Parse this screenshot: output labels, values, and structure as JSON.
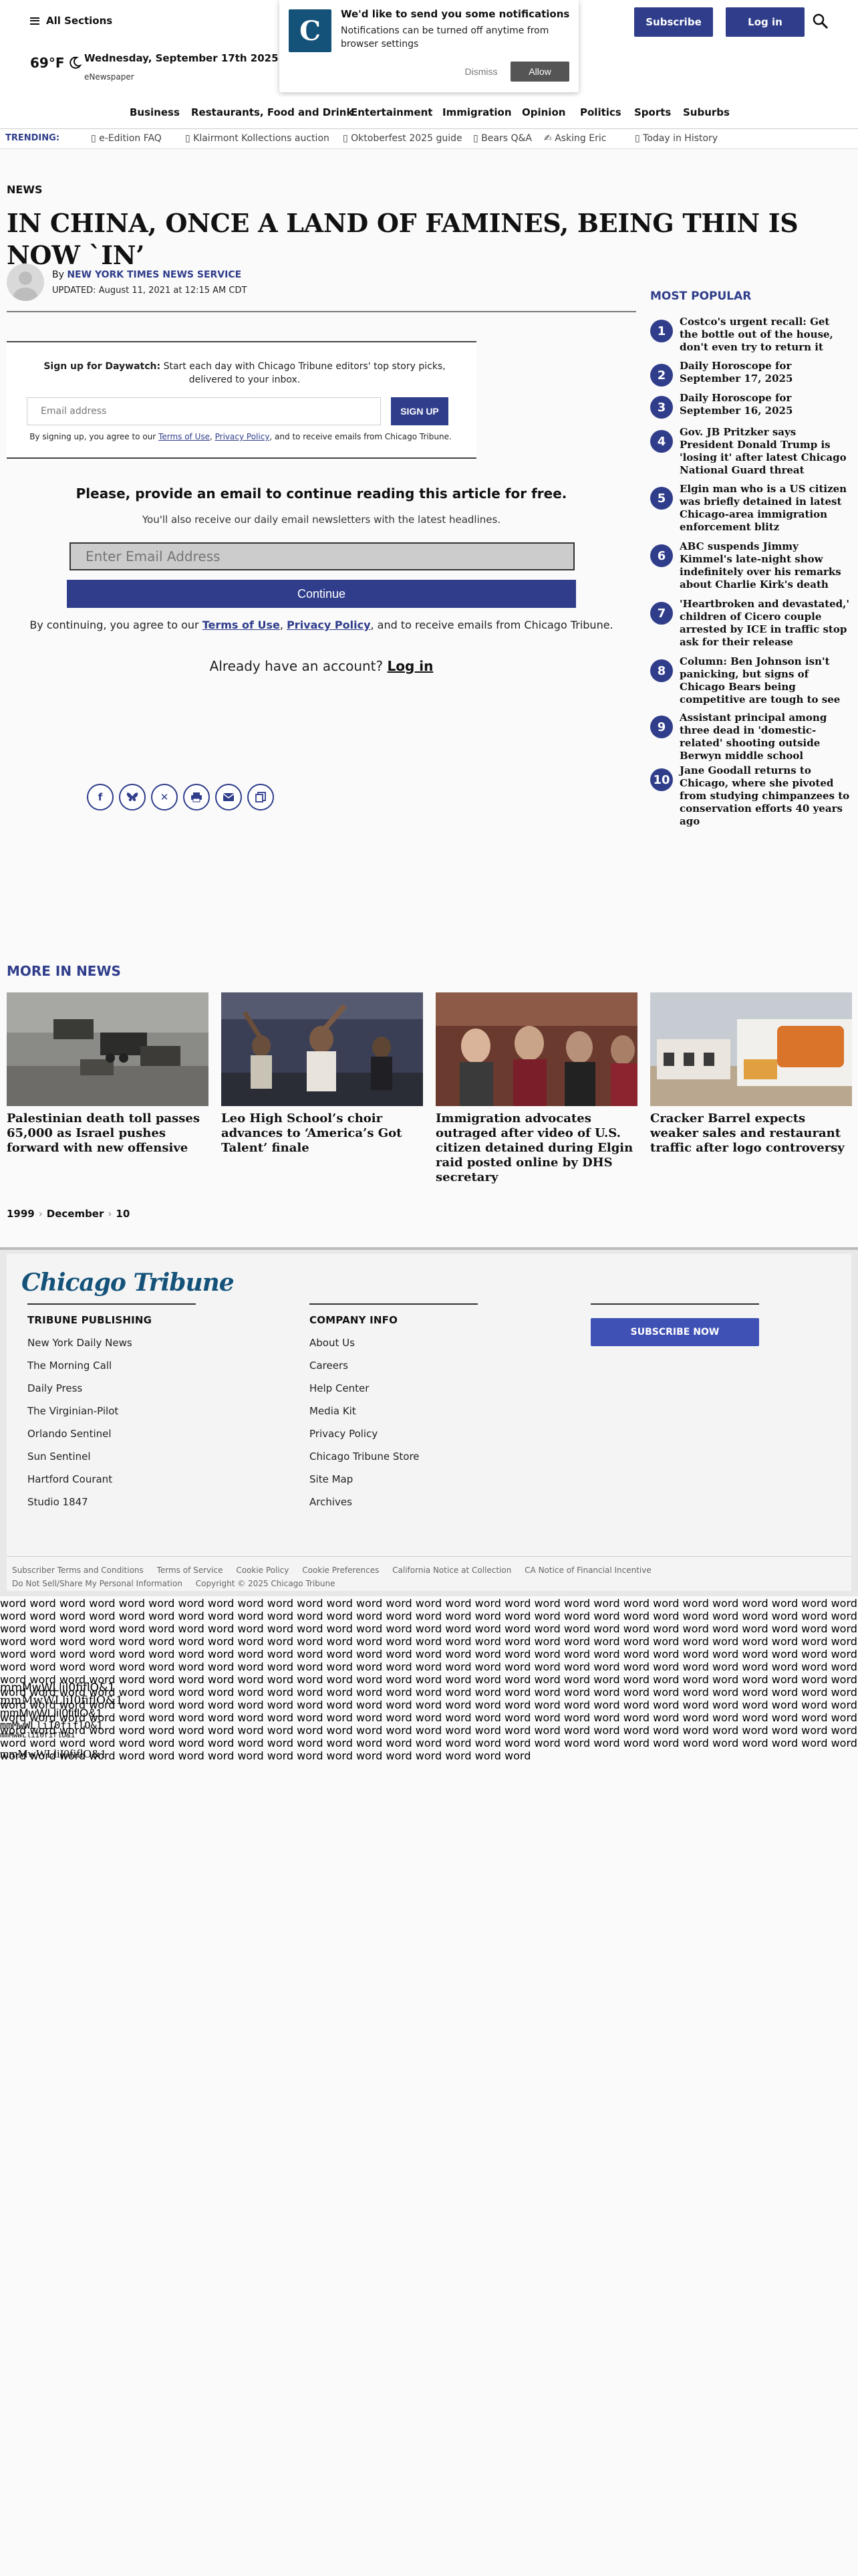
{
  "header": {
    "all_sections": "All Sections",
    "weather": "69°F",
    "date": "Wednesday, September 17th 2025",
    "enewspaper": "eNewspaper",
    "subscribe": "Subscribe",
    "login": "Log in"
  },
  "notification": {
    "logo_letter": "C",
    "title": "We'd like to send you some notifications",
    "text": "Notifications can be turned off anytime from browser settings",
    "dismiss": "Dismiss",
    "allow": "Allow"
  },
  "nav": {
    "items": [
      "Business",
      "Restaurants, Food and Drink",
      "Entertainment",
      "Immigration",
      "Opinion",
      "Politics",
      "Sports",
      "Suburbs"
    ]
  },
  "trending": {
    "label": "TRENDING:",
    "items": [
      "e-Edition FAQ",
      "Klairmont Kollections auction",
      "Oktoberfest 2025 guide",
      "Bears Q&A",
      "Asking Eric",
      "Today in History"
    ]
  },
  "article": {
    "section": "NEWS",
    "headline": "IN CHINA, ONCE A LAND OF FAMINES, BEING THIN IS NOW `IN’",
    "by_prefix": "By",
    "author": "NEW YORK TIMES NEWS SERVICE",
    "updated": "UPDATED: August 11, 2021 at 12:15 AM CDT"
  },
  "signup": {
    "lead": "Sign up for Daywatch:",
    "text": "Start each day with Chicago Tribune editors' top story picks, delivered to your inbox.",
    "placeholder": "Email address",
    "button": "SIGN UP",
    "legal_pre": "By signing up, you agree to our",
    "terms": "Terms of Use",
    "privacy": "Privacy Policy",
    "legal_post": ", and to receive emails from Chicago Tribune."
  },
  "paywall": {
    "title": "Please, provide an email to continue reading this article for free.",
    "subtitle": "You'll also receive our daily email newsletters with the latest headlines.",
    "placeholder": "Enter Email Address",
    "button": "Continue",
    "legal_pre": "By continuing, you agree to our",
    "terms": "Terms of Use",
    "privacy": "Privacy Policy",
    "legal_post": ", and to receive emails from Chicago Tribune.",
    "login_prompt": "Already have an account?",
    "login_link": "Log in"
  },
  "share": {
    "icons": [
      "facebook-icon",
      "bluesky-icon",
      "x-icon",
      "print-icon",
      "email-icon",
      "copy-link-icon"
    ]
  },
  "most_popular": {
    "title": "MOST POPULAR",
    "items": [
      {
        "num": "1",
        "text": "Costco's urgent recall: Get the bottle out of the house, don't even try to return it"
      },
      {
        "num": "2",
        "text": "Daily Horoscope for September 17, 2025"
      },
      {
        "num": "3",
        "text": "Daily Horoscope for September 16, 2025"
      },
      {
        "num": "4",
        "text": "Gov. JB Pritzker says President Donald Trump is 'losing it' after latest Chicago National Guard threat"
      },
      {
        "num": "5",
        "text": "Elgin man who is a US citizen was briefly detained in latest Chicago-area immigration enforcement blitz"
      },
      {
        "num": "6",
        "text": "ABC suspends Jimmy Kimmel's late-night show indefinitely over his remarks about Charlie Kirk's death"
      },
      {
        "num": "7",
        "text": "'Heartbroken and devastated,' children of Cicero couple arrested by ICE in traffic stop ask for their release"
      },
      {
        "num": "8",
        "text": "Column: Ben Johnson isn't panicking, but signs of Chicago Bears being competitive are tough to see"
      },
      {
        "num": "9",
        "text": "Assistant principal among three dead in 'domestic-related' shooting outside Berwyn middle school"
      },
      {
        "num": "10",
        "text": "Jane Goodall returns to Chicago, where she pivoted from studying chimpanzees to conservation efforts 40 years ago"
      }
    ]
  },
  "more_in_news": {
    "title": "MORE IN NEWS",
    "items": [
      {
        "headline": "Palestinian death toll passes 65,000 as Israel pushes forward with new offensive"
      },
      {
        "headline": "Leo High School’s choir advances to ‘America’s Got Talent’ finale"
      },
      {
        "headline": "Immigration advocates outraged after video of U.S. citizen detained during Elgin raid posted online by DHS secretary"
      },
      {
        "headline": "Cracker Barrel expects weaker sales and restaurant traffic after logo controversy"
      }
    ]
  },
  "breadcrumb": [
    "1999",
    "December",
    "10"
  ],
  "footer": {
    "logo": "Chicago Tribune",
    "col1_title": "TRIBUNE PUBLISHING",
    "col1_links": [
      "New York Daily News",
      "The Morning Call",
      "Daily Press",
      "The Virginian-Pilot",
      "Orlando Sentinel",
      "Sun Sentinel",
      "Hartford Courant",
      "Studio 1847"
    ],
    "col2_title": "COMPANY INFO",
    "col2_links": [
      "About Us",
      "Careers",
      "Help Center",
      "Media Kit",
      "Privacy Policy",
      "Chicago Tribune Store",
      "Site Map",
      "Archives"
    ],
    "subscribe_now": "SUBSCRIBE NOW",
    "legal_links": [
      "Subscriber Terms and Conditions",
      "Terms of Service",
      "Cookie Policy",
      "Cookie Preferences",
      "California Notice at Collection",
      "CA Notice of Financial Incentive"
    ],
    "legal_links2": [
      "Do Not Sell/Share My Personal Information",
      "Copyright © 2025 Chicago Tribune"
    ]
  },
  "word_block": "word word word word word word word word word word word word word word word word word word word word word word word word word word word word word word word word word word word word word word word word word word word word word word word word word word word word word word word word word word word word word word word word word word word word word word word word word word word word word word word word word word word word word word word word word word word word word word word word word word word word word word word word word word word word word word word word word word word word word word word word word word word word word word word word word word word word word word word word word word word word word word word word word word word word word word word word word word word word word word word word word word word word word word word word word word word word word word word word word word word word word word word word word word word word word word word word word word word word word word word word word word word word word word word word word word word word word word word word word word word word word word word word word word word word word word word word word word word word word word word word word word word word word word word word word word word word word word word word word word word word word word word word word word word word word word word word word word word word word word word word word word word word word word word word word word word word word word word word word word word word word word word word word word word word word word word word word word word word word word word word word word word word word word word word word word word word word word word word word word word word word word word word word word word word word word word word word word word word word word word word word word word word word word",
  "font_samples": [
    "mmMwWLliI0fiflO&1",
    "mmMwWLliI0fiflO&1",
    "mmMwWLliI0fiflO&1",
    "mmMwWLliI0fiflO&1",
    "mmMwWLliI0fiflO&1",
    "mmMwWLliI0fiflO&1"
  ]
}
